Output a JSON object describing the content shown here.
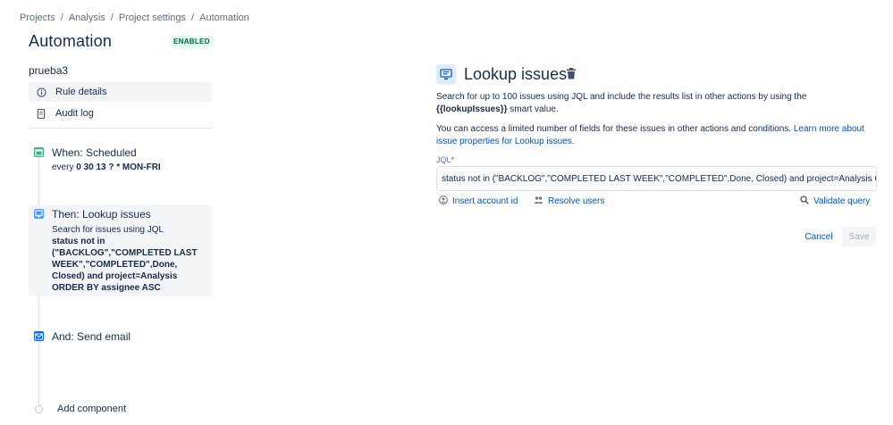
{
  "breadcrumb": [
    "Projects",
    "Analysis",
    "Project settings",
    "Automation"
  ],
  "page": {
    "title": "Automation",
    "status_badge": "ENABLED"
  },
  "rule": {
    "name": "prueba3"
  },
  "sidebar": {
    "items": [
      {
        "label": "Rule details",
        "icon": "info-icon"
      },
      {
        "label": "Audit log",
        "icon": "document-icon"
      }
    ]
  },
  "steps": {
    "trigger": {
      "title": "When: Scheduled",
      "desc_prefix": "every ",
      "desc_value": "0 30 13 ? * MON-FRI",
      "color": "#36b37e"
    },
    "action": {
      "title": "Then: Lookup issues",
      "desc_line": "Search for issues using JQL",
      "query": "status not in (\"BACKLOG\",\"COMPLETED LAST WEEK\",\"COMPLETED\",Done, Closed) and project=Analysis ORDER BY assignee ASC",
      "color": "#4c9aff"
    },
    "email": {
      "title": "And: Send email",
      "color": "#0065ff"
    },
    "add_component": "Add component"
  },
  "panel": {
    "title": "Lookup issues",
    "desc1_pre": "Search for up to 100 issues using JQL and include the results list in other actions by using the ",
    "desc1_code": "{{lookupIssues}}",
    "desc1_post": " smart value.",
    "desc2_pre": "You can access a limited number of fields for these issues in other actions and conditions. ",
    "desc2_link": "Learn more about issue properties for Lookup issues.",
    "jql_label": "JQL",
    "jql_required": "*",
    "jql_value": "status not in (\"BACKLOG\",\"COMPLETED LAST WEEK\",\"COMPLETED\",Done, Closed) and project=Analysis ORDER BY assignee ASC",
    "insert_account": "Insert account id",
    "resolve_users": "Resolve users",
    "validate_query": "Validate query",
    "cancel": "Cancel",
    "save": "Save"
  }
}
